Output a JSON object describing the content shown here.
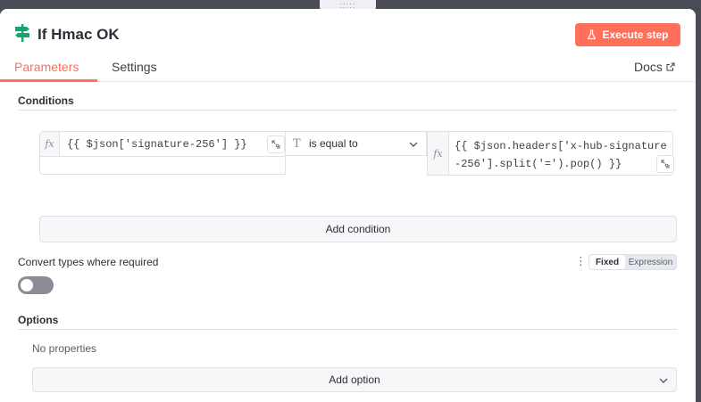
{
  "drag_handle": {
    "glyph": "::::: "
  },
  "header": {
    "title": "If Hmac OK",
    "execute_label": "Execute step",
    "accent": "#ff6f5c",
    "tabs": [
      {
        "label": "Parameters",
        "active": true
      },
      {
        "label": "Settings",
        "active": false
      }
    ],
    "docs_label": "Docs"
  },
  "conditions": {
    "title": "Conditions",
    "left_value": "{{ $json['signature-256'] }}",
    "left_type_icon": "fx",
    "operator_icon": "T",
    "operator": "is equal to",
    "right_type_icon": "fx",
    "right_value": "{{ $json.headers['x-hub-signature-256'].split('=').pop() }}",
    "add_condition_label": "Add condition"
  },
  "convert": {
    "label": "Convert types where required",
    "dots": "⋮",
    "mode_fixed": "Fixed",
    "mode_expression": "Expression",
    "enabled": false
  },
  "options": {
    "title": "Options",
    "empty_text": "No properties",
    "add_option_label": "Add option"
  }
}
